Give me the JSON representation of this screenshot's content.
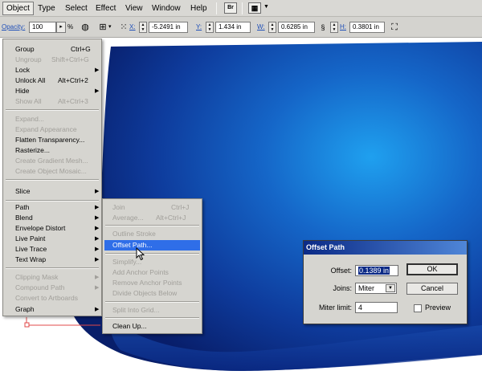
{
  "menubar": {
    "items": [
      "Object",
      "Type",
      "Select",
      "Effect",
      "View",
      "Window",
      "Help"
    ],
    "icon_br": "Br"
  },
  "controlbar": {
    "opacity_label": "Opacity:",
    "opacity_value": "100",
    "opacity_unit": "%",
    "x_label": "X:",
    "x_value": "-5.2491 in",
    "y_label": "Y:",
    "y_value": "1.434 in",
    "w_label": "W:",
    "w_value": "0.6285 in",
    "h_label": "H:",
    "h_value": "0.3801 in"
  },
  "object_menu": {
    "items": [
      {
        "label": "Group",
        "shortcut": "Ctrl+G",
        "enabled": true
      },
      {
        "label": "Ungroup",
        "shortcut": "Shift+Ctrl+G",
        "enabled": false
      },
      {
        "label": "Lock",
        "submenu": true,
        "enabled": true
      },
      {
        "label": "Unlock All",
        "shortcut": "Alt+Ctrl+2",
        "enabled": true
      },
      {
        "label": "Hide",
        "submenu": true,
        "enabled": true
      },
      {
        "label": "Show All",
        "shortcut": "Alt+Ctrl+3",
        "enabled": false
      },
      {
        "label": "Expand...",
        "enabled": false
      },
      {
        "label": "Expand Appearance",
        "enabled": false
      },
      {
        "label": "Flatten Transparency...",
        "enabled": true
      },
      {
        "label": "Rasterize...",
        "enabled": true
      },
      {
        "label": "Create Gradient Mesh...",
        "enabled": false
      },
      {
        "label": "Create Object Mosaic...",
        "enabled": false
      },
      {
        "label": "Slice",
        "submenu": true,
        "enabled": true
      },
      {
        "label": "Path",
        "submenu": true,
        "enabled": true
      },
      {
        "label": "Blend",
        "submenu": true,
        "enabled": true
      },
      {
        "label": "Envelope Distort",
        "submenu": true,
        "enabled": true
      },
      {
        "label": "Live Paint",
        "submenu": true,
        "enabled": true
      },
      {
        "label": "Live Trace",
        "submenu": true,
        "enabled": true
      },
      {
        "label": "Text Wrap",
        "submenu": true,
        "enabled": true
      },
      {
        "label": "Clipping Mask",
        "submenu": true,
        "enabled": false
      },
      {
        "label": "Compound Path",
        "submenu": true,
        "enabled": false
      },
      {
        "label": "Convert to Artboards",
        "enabled": false
      },
      {
        "label": "Graph",
        "submenu": true,
        "enabled": true
      }
    ]
  },
  "path_submenu": {
    "items": [
      {
        "label": "Join",
        "shortcut": "Ctrl+J",
        "enabled": false
      },
      {
        "label": "Average...",
        "shortcut": "Alt+Ctrl+J",
        "enabled": false
      },
      {
        "label": "Outline Stroke",
        "enabled": false
      },
      {
        "label": "Offset Path...",
        "enabled": true,
        "highlighted": true
      },
      {
        "label": "Simplify...",
        "enabled": false
      },
      {
        "label": "Add Anchor Points",
        "enabled": false
      },
      {
        "label": "Remove Anchor Points",
        "enabled": false
      },
      {
        "label": "Divide Objects Below",
        "enabled": false
      },
      {
        "label": "Split Into Grid...",
        "enabled": false
      },
      {
        "label": "Clean Up...",
        "enabled": true
      }
    ]
  },
  "offset_dialog": {
    "title": "Offset Path",
    "offset_label": "Offset:",
    "offset_value": "0.1389 in",
    "joins_label": "Joins:",
    "joins_value": "Miter",
    "miter_label": "Miter limit:",
    "miter_value": "4",
    "ok_label": "OK",
    "cancel_label": "Cancel",
    "preview_label": "Preview",
    "preview_checked": false
  },
  "colors": {
    "shape_light": "#1f8fe6",
    "shape_dark": "#0a1f6e",
    "selection_red": "#e04848",
    "menu_highlight": "#2f6ee8"
  }
}
